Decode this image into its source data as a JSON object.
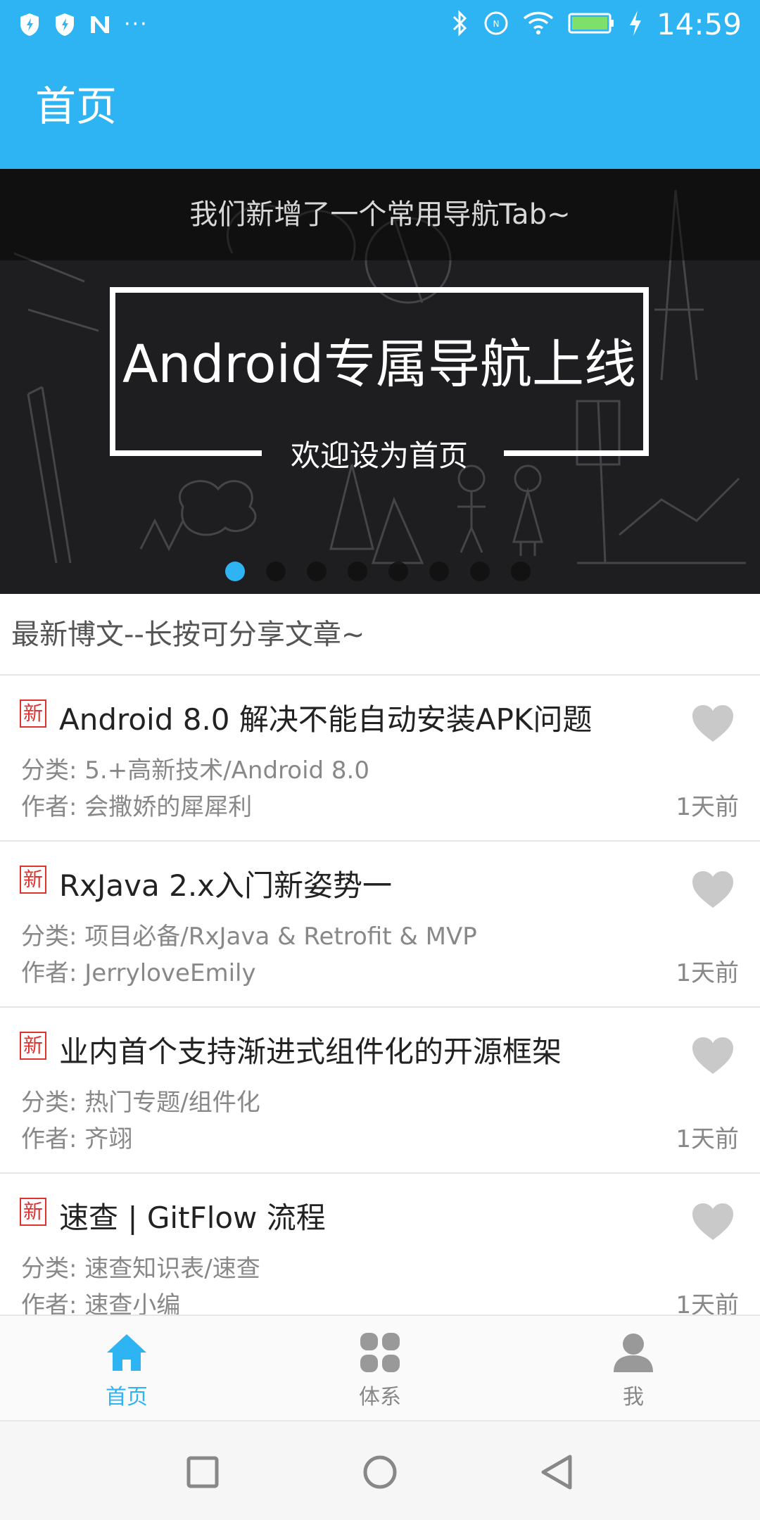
{
  "status_bar": {
    "time": "14:59",
    "left_icons": [
      "shield-icon",
      "shield-icon",
      "nfc-n-icon"
    ],
    "overflow": "···",
    "right_icons": [
      "bluetooth-icon",
      "nfc-icon",
      "wifi-icon",
      "battery-icon",
      "charging-icon"
    ]
  },
  "app_bar": {
    "title": "首页"
  },
  "banner": {
    "caption": "我们新增了一个常用导航Tab~",
    "headline": "Android专属导航上线",
    "subline": "欢迎设为首页",
    "page_count": 8,
    "active_index": 0
  },
  "section": {
    "title": "最新博文--长按可分享文章~"
  },
  "articles": [
    {
      "tag": "新",
      "title": "Android 8.0 解决不能自动安装APK问题",
      "category": "分类: 5.+高新技术/Android 8.0",
      "author": "作者: 会撒娇的犀犀利",
      "time": "1天前"
    },
    {
      "tag": "新",
      "title": "RxJava 2.x入门新姿势一",
      "category": "分类: 项目必备/RxJava & Retrofit & MVP",
      "author": "作者:  JerryloveEmily",
      "time": "1天前"
    },
    {
      "tag": "新",
      "title": "业内首个支持渐进式组件化的开源框架",
      "category": "分类: 热门专题/组件化",
      "author": "作者: 齐翊",
      "time": "1天前"
    },
    {
      "tag": "新",
      "title": "速查 | GitFlow 流程",
      "category": "分类: 速查知识表/速查",
      "author": "作者: 速查小编",
      "time": "1天前"
    }
  ],
  "tabs": [
    {
      "label": "首页",
      "icon": "home-icon"
    },
    {
      "label": "体系",
      "icon": "grid-icon"
    },
    {
      "label": "我",
      "icon": "person-icon"
    }
  ],
  "colors": {
    "accent": "#2eb4f3",
    "new_tag": "#e0322e",
    "heart": "#c9c9c9",
    "secondary_text": "#888888"
  }
}
